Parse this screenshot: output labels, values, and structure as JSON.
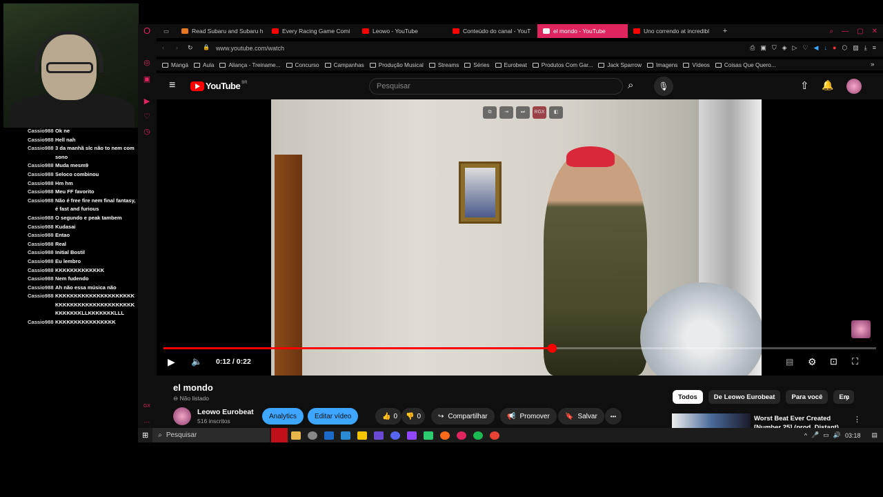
{
  "chat": [
    {
      "user": "Cassio988",
      "msg": "Ok ne"
    },
    {
      "user": "Cassio988",
      "msg": "Hell nah"
    },
    {
      "user": "Cassio988",
      "msg": "3 da manhã slc não to nem com sono"
    },
    {
      "user": "Cassio988",
      "msg": "Muda mesm9"
    },
    {
      "user": "Cassio988",
      "msg": "Seloco combinou"
    },
    {
      "user": "Cassio988",
      "msg": "Hm hm"
    },
    {
      "user": "Cassio988",
      "msg": "Meu FF favorito"
    },
    {
      "user": "Cassio988",
      "msg": "Não é free fire nem final fantasy, é fast and furious"
    },
    {
      "user": "Cassio988",
      "msg": "O segundo e peak tambem"
    },
    {
      "user": "Cassio988",
      "msg": "Kudasai"
    },
    {
      "user": "Cassio988",
      "msg": "Entao"
    },
    {
      "user": "Cassio988",
      "msg": "Real"
    },
    {
      "user": "Cassio988",
      "msg": "Initial Bostil"
    },
    {
      "user": "Cassio988",
      "msg": "Eu lembro"
    },
    {
      "user": "Cassio988",
      "msg": "KKKKKKKKKKKKK"
    },
    {
      "user": "Cassio988",
      "msg": "Nem fudendo"
    },
    {
      "user": "Cassio988",
      "msg": "Ah não essa música não"
    },
    {
      "user": "Cassio988",
      "msg": "KKKKKKKKKKKKKKKKKKKKKKKKKKKKKKKKKKKKKKKKKKKKKKKKKLLKKKKKKKLLL"
    },
    {
      "user": "Cassio988",
      "msg": "KKKKKKKKKKKKKKKK"
    }
  ],
  "tabs": [
    {
      "label": "Read Subaru and Subaru h",
      "active": false,
      "color": "#e87722"
    },
    {
      "label": "Every Racing Game Comi",
      "active": false,
      "color": "#ff0000"
    },
    {
      "label": "Leowo - YouTube",
      "active": false,
      "color": "#ff0000"
    },
    {
      "label": "Conteúdo do canal - YouT",
      "active": false,
      "color": "#ff0000"
    },
    {
      "label": "el mondo - YouTube",
      "active": true,
      "color": "#ff0000"
    },
    {
      "label": "Uno correndo at incredibl",
      "active": false,
      "color": "#ff0000"
    }
  ],
  "tab_add": "+",
  "url": "www.youtube.com/watch",
  "bookmarks": [
    "Mangá",
    "Aula",
    "Aliança - Treiname...",
    "Concurso",
    "Campanhas",
    "Produção Musical",
    "Streams",
    "Séries",
    "Eurobeat",
    "Produtos Com Gar...",
    "Jack Sparrow",
    "Imagens",
    "Vídeos",
    "Coisas Que Quero..."
  ],
  "yt": {
    "logo_text": "YouTube",
    "region": "BR",
    "search_placeholder": "Pesquisar"
  },
  "video_overlay": {
    "rgx": "RGX"
  },
  "player": {
    "time": "0:12 / 0:22",
    "progress": 0.545
  },
  "video": {
    "title": "el mondo",
    "visibility": "Não listado",
    "channel": "Leowo Eurobeat",
    "subs": "516 inscritos",
    "analytics": "Analytics",
    "edit": "Editar vídeo",
    "likes": "0",
    "dislikes": "0",
    "share": "Compartilhar",
    "promote": "Promover",
    "save": "Salvar",
    "more": "•••"
  },
  "chips": [
    "Todos",
    "De Leowo Eurobeat",
    "Para você",
    "Em"
  ],
  "recommended": {
    "title": "Worst Beat Ever Created [Number 25] (prod. Distant)"
  },
  "taskbar": {
    "search": "Pesquisar",
    "time": "03:18"
  }
}
